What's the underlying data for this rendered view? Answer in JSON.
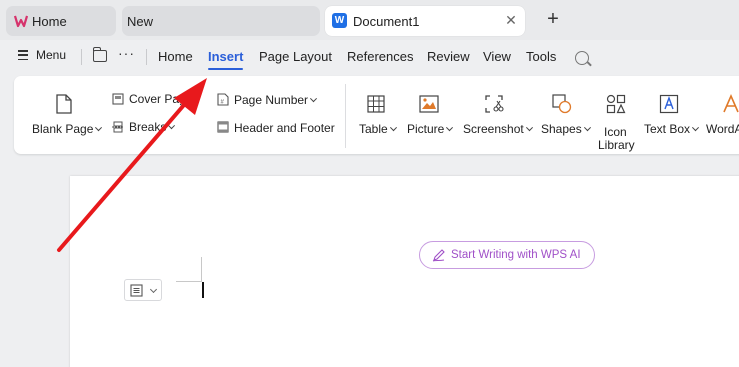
{
  "tabs": {
    "home": "Home",
    "new": "New",
    "document": "Document1"
  },
  "menubar": {
    "menu": "Menu",
    "items": [
      "Home",
      "Insert",
      "Page Layout",
      "References",
      "Review",
      "View",
      "Tools"
    ],
    "active": "Insert",
    "accent": "#2b5fd9"
  },
  "ribbon": {
    "blank_page": "Blank Page",
    "cover_page": "Cover Page",
    "breaks": "Breaks",
    "page_number": "Page Number",
    "header_footer": "Header and Footer",
    "table": "Table",
    "picture": "Picture",
    "screenshot": "Screenshot",
    "shapes": "Shapes",
    "icon_library_1": "Icon",
    "icon_library_2": "Library",
    "text_box": "Text Box",
    "wordart": "WordArt"
  },
  "document": {
    "ai_button": "Start Writing with WPS AI",
    "ai_color": "#a050c8"
  },
  "annotation": {
    "arrow_color": "#e8191c"
  }
}
